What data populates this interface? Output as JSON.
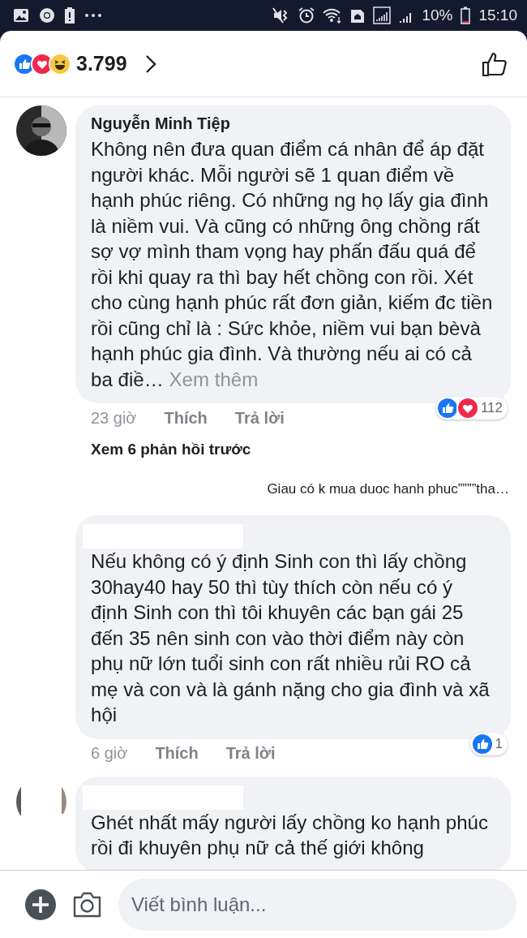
{
  "status_bar": {
    "battery": "10%",
    "time": "15:10"
  },
  "reactions_bar": {
    "reactions": [
      {
        "kind": "like"
      },
      {
        "kind": "heart"
      },
      {
        "kind": "laugh"
      }
    ],
    "count": "3.799"
  },
  "thread": [
    {
      "kind": "comment",
      "has_avatar": true,
      "name_redacted": false,
      "author": "Nguyễn Minh Tiệp",
      "text": "Không nên đưa quan điểm cá nhân để áp đặt người khác. Mỗi người sẽ 1 quan điểm về hạnh phúc riêng. Có những ng họ lấy gia đình là niềm vui. Và cũng có những ông chồng rất sợ vợ mình tham vọng hay phấn đấu quá để rồi khi quay ra thì bay hết chồng con rồi. Xét cho cùng hạnh phúc rất đơn giản, kiếm đc tiền rồi cũng chỉ là : Sức khỏe, niềm vui bạn bèvà hạnh phúc gia đình. Và thường nếu ai có cả ba điề…",
      "see_more": "Xem thêm",
      "time": "23 giờ",
      "like": "Thích",
      "reply": "Trả lời",
      "reactions": [
        {
          "kind": "like"
        },
        {
          "kind": "heart"
        }
      ],
      "reaction_count": "112"
    },
    {
      "kind": "more_replies",
      "label": "Xem 6 phản hồi trước"
    },
    {
      "kind": "reply_preview",
      "text": "Giau có k mua duoc hanh phuc””””tha…"
    },
    {
      "kind": "comment",
      "has_avatar": false,
      "name_redacted": true,
      "text": "Nếu không có ý định Sinh con thì lấy chồng 30hay40 hay 50 thì tùy thích còn nếu có ý định Sinh con thì tôi khuyên các bạn gái 25 đến 35 nên sinh con vào thời điểm này còn phụ nữ lớn tuổi sinh con rất nhiều rủi RO cả mẹ và con và là gánh nặng cho gia đình và xã hội",
      "time": "6 giờ",
      "like": "Thích",
      "reply": "Trả lời",
      "reactions": [
        {
          "kind": "like"
        }
      ],
      "reaction_count": "1"
    },
    {
      "kind": "comment",
      "has_avatar": true,
      "name_redacted": true,
      "text": "Ghét nhất mấy người lấy chồng ko hạnh phúc rồi đi khuyên phụ nữ cả thế giới không"
    }
  ],
  "composer": {
    "placeholder": "Viết bình luận..."
  }
}
